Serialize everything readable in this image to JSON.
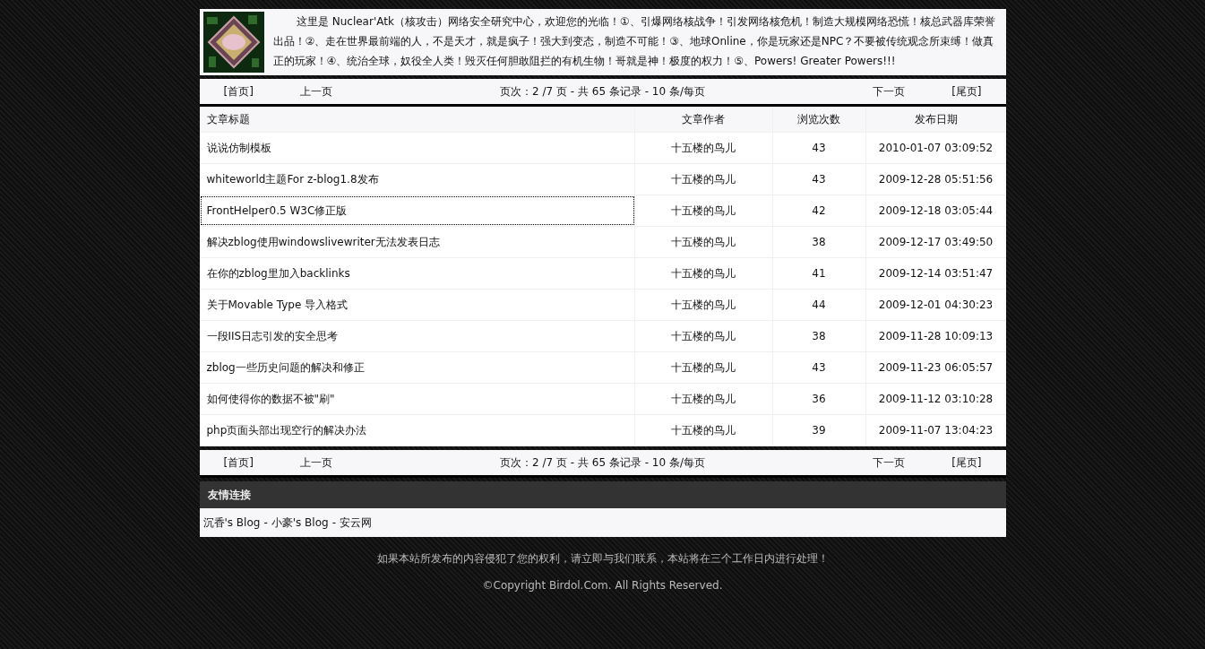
{
  "header": {
    "intro": "这里是 Nuclear'Atk（核攻击）网络安全研究中心，欢迎您的光临！①、引爆网络核战争！引发网络核危机！制造大规模网络恐慌！核总武器库荣誉出品！②、走在世界最前端的人，不是天才，就是疯子！强大到变态，制造不可能！③、地球Online，你是玩家还是NPC？不要被传统观念所束缚！做真正的玩家！④、统治全球，奴役全人类！毁灭任何胆敢阻拦的有机生物！哥就是神！极度的权力！⑤、Powers! Greater Powers!!!"
  },
  "pager_top": {
    "first": "[首页]",
    "prev": "上一页",
    "info": "页次：2 /7 页 - 共 65 条记录 - 10 条/每页",
    "next": "下一页",
    "last": "[尾页]"
  },
  "table": {
    "columns": [
      "文章标题",
      "文章作者",
      "浏览次数",
      "发布日期"
    ],
    "rows": [
      {
        "title": "说说仿制模板",
        "author": "十五楼的鸟儿",
        "views": "43",
        "date": "2010-01-07 03:09:52",
        "selected": false
      },
      {
        "title": "whiteworld主题For z-blog1.8发布",
        "author": "十五楼的鸟儿",
        "views": "43",
        "date": "2009-12-28 05:51:56",
        "selected": false
      },
      {
        "title": "FrontHelper0.5 W3C修正版",
        "author": "十五楼的鸟儿",
        "views": "42",
        "date": "2009-12-18 03:05:44",
        "selected": true
      },
      {
        "title": "解决zblog使用windowslivewriter无法发表日志",
        "author": "十五楼的鸟儿",
        "views": "38",
        "date": "2009-12-17 03:49:50",
        "selected": false
      },
      {
        "title": "在你的zblog里加入backlinks",
        "author": "十五楼的鸟儿",
        "views": "41",
        "date": "2009-12-14 03:51:47",
        "selected": false
      },
      {
        "title": "关于Movable Type 导入格式",
        "author": "十五楼的鸟儿",
        "views": "44",
        "date": "2009-12-01 04:30:23",
        "selected": false
      },
      {
        "title": "一段IIS日志引发的安全思考",
        "author": "十五楼的鸟儿",
        "views": "38",
        "date": "2009-11-28 10:09:13",
        "selected": false
      },
      {
        "title": "zblog一些历史问题的解决和修正",
        "author": "十五楼的鸟儿",
        "views": "43",
        "date": "2009-11-23 06:05:57",
        "selected": false
      },
      {
        "title": "如何使得你的数据不被\"刷\"",
        "author": "十五楼的鸟儿",
        "views": "36",
        "date": "2009-11-12 03:10:28",
        "selected": false
      },
      {
        "title": "php页面头部出现空行的解决办法",
        "author": "十五楼的鸟儿",
        "views": "39",
        "date": "2009-11-07 13:04:23",
        "selected": false
      }
    ]
  },
  "pager_bottom": {
    "first": "[首页]",
    "prev": "上一页",
    "info": "页次：2 /7 页 - 共 65 条记录 - 10 条/每页",
    "next": "下一页",
    "last": "[尾页]"
  },
  "links": {
    "title": "友情连接",
    "separator": "-",
    "items": [
      "沉香's Blog",
      "小豪's Blog",
      "安云网"
    ]
  },
  "footer": {
    "notice": "如果本站所发布的内容侵犯了您的权利，请立即与我们联系，本站将在三个工作日内进行处理！",
    "copyright": "©Copyright Birdol.Com. All Rights Reserved."
  }
}
